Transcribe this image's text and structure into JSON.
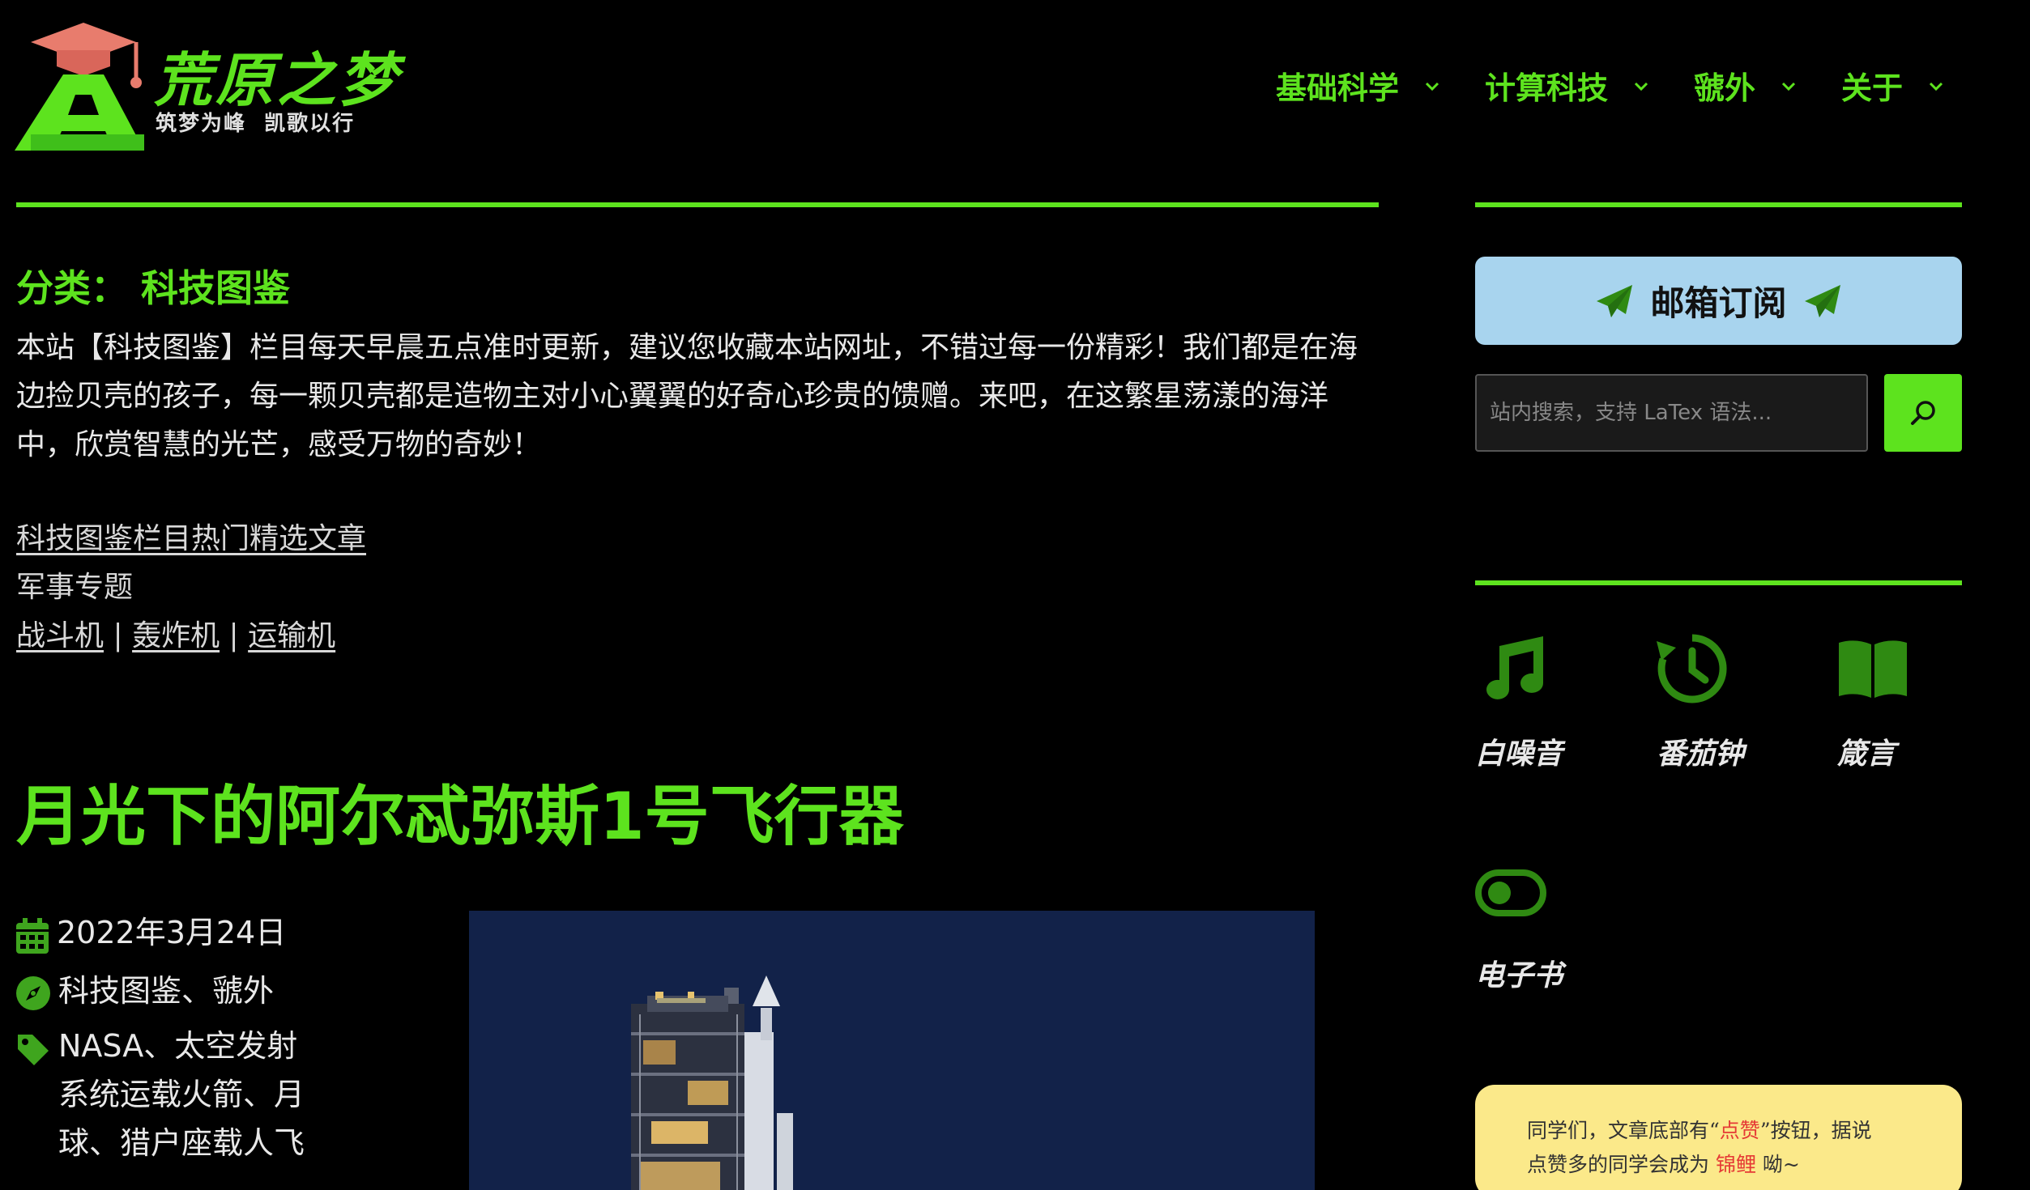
{
  "site": {
    "title": "荒原之梦",
    "tagline": "筑梦为峰  凯歌以行"
  },
  "nav": [
    {
      "label": "基础科学"
    },
    {
      "label": "计算科技"
    },
    {
      "label": "虢外"
    },
    {
      "label": "关于"
    }
  ],
  "category": {
    "heading": "分类： 科技图鉴",
    "intro": "本站【科技图鉴】栏目每天早晨五点准时更新，建议您收藏本站网址，不错过每一份精彩！我们都是在海边捡贝壳的孩子，每一颗贝壳都是造物主对小心翼翼的好奇心珍贵的馈赠。来吧，在这繁星荡漾的海洋中，欣赏智慧的光芒，感受万物的奇妙！",
    "featured_link": "科技图鉴栏目热门精选文章",
    "topic_label": "军事专题",
    "topics": [
      "战斗机",
      "轰炸机",
      "运输机"
    ],
    "separator": "|"
  },
  "post": {
    "title": "月光下的阿尔忒弥斯1号飞行器",
    "date": "2022年3月24日",
    "categories": "科技图鉴、虢外",
    "tags": "NASA、太空发射系统运载火箭、月球、猎户座载人飞"
  },
  "sidebar": {
    "subscribe_label": "邮箱订阅",
    "search_placeholder": "站内搜索，支持 LaTex 语法...",
    "tools": [
      {
        "label": "白噪音",
        "icon": "music-note-icon"
      },
      {
        "label": "番茄钟",
        "icon": "history-clock-icon"
      },
      {
        "label": "箴言",
        "icon": "open-book-icon"
      },
      {
        "label": "电子书",
        "icon": "toggle-icon"
      }
    ],
    "notice": {
      "line1_pre": "同学们，文章底部有“",
      "line1_hl": "点赞",
      "line1_post": "”按钮，据说",
      "line2_pre": "点赞多的同学会成为 ",
      "line2_hl": "锦鲤",
      "line2_post": " 呦~"
    }
  },
  "colors": {
    "accent": "#5de31e",
    "background": "#000000",
    "subscribe_bg": "#a8d4ee",
    "notice_bg": "#fbe98a",
    "highlight": "#e53935"
  }
}
